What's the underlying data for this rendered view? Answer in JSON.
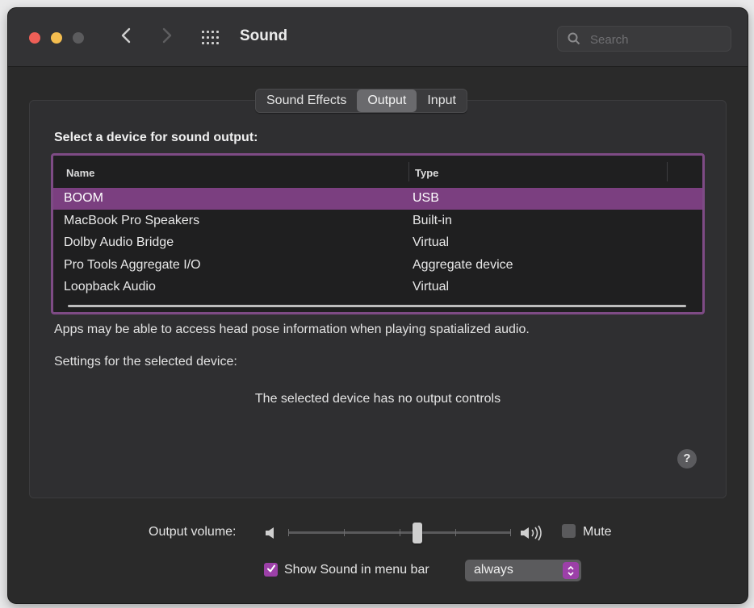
{
  "window": {
    "title": "Sound"
  },
  "search": {
    "placeholder": "Search"
  },
  "tabs": [
    {
      "label": "Sound Effects",
      "active": false
    },
    {
      "label": "Output",
      "active": true
    },
    {
      "label": "Input",
      "active": false
    }
  ],
  "output": {
    "heading": "Select a device for sound output:",
    "columns": {
      "name": "Name",
      "type": "Type"
    },
    "devices": [
      {
        "name": "BOOM",
        "type": "USB",
        "selected": true
      },
      {
        "name": "MacBook Pro Speakers",
        "type": "Built-in",
        "selected": false
      },
      {
        "name": "Dolby Audio Bridge",
        "type": "Virtual",
        "selected": false
      },
      {
        "name": "Pro Tools Aggregate I/O",
        "type": "Aggregate device",
        "selected": false
      },
      {
        "name": "Loopback Audio",
        "type": "Virtual",
        "selected": false
      }
    ],
    "head_pose_note": "Apps may be able to access head pose information when playing spatialized audio.",
    "settings_label": "Settings for the selected device:",
    "no_controls": "The selected device has no output controls",
    "help": "?"
  },
  "volume": {
    "label": "Output volume:",
    "level": 0.58,
    "mute_label": "Mute",
    "muted": false
  },
  "menu_bar": {
    "label": "Show Sound in menu bar",
    "checked": true,
    "option": "always"
  },
  "colors": {
    "selection": "#7b3f80",
    "table_focus_border": "#7e4b85",
    "accent_control": "#9c40a8",
    "window_bg": "#2a2a2a"
  },
  "icons": [
    "back-chevron-icon",
    "forward-chevron-icon",
    "grid-icon",
    "search-icon",
    "speaker-low-icon",
    "speaker-high-icon",
    "checkmark-icon",
    "updown-chevron-icon"
  ]
}
